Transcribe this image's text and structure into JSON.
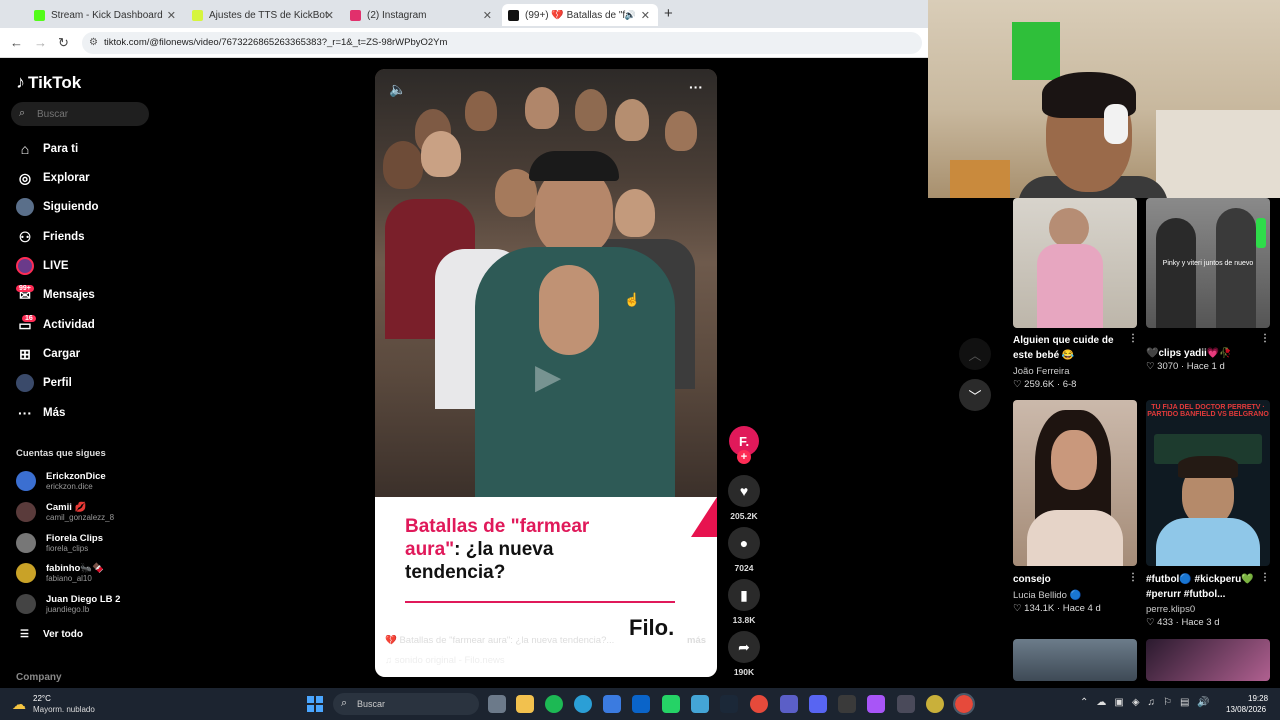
{
  "browser": {
    "tabs": [
      {
        "title": "Stream - Kick Dashboard",
        "favicon_color": "#53fc18"
      },
      {
        "title": "Ajustes de TTS de KickBot",
        "favicon_color": "#d6f53d"
      },
      {
        "title": "(2) Instagram",
        "favicon_color": "#e1306c"
      },
      {
        "title": "(99+) 💔 Batallas de \"farme",
        "favicon_color": "#111111"
      }
    ],
    "close_glyph": "✕",
    "new_tab_glyph": "+",
    "url": "tiktok.com/@filonews/video/7673226865263365383?_r=1&_t=ZS-98rWPbyO2Ym"
  },
  "sidebar": {
    "brand": "TikTok",
    "search_placeholder": "Buscar",
    "nav": [
      {
        "label": "Para ti",
        "icon": "home-icon"
      },
      {
        "label": "Explorar",
        "icon": "compass-icon"
      },
      {
        "label": "Siguiendo",
        "icon": "following-icon"
      },
      {
        "label": "Friends",
        "icon": "friends-icon"
      },
      {
        "label": "LIVE",
        "icon": "live-icon"
      },
      {
        "label": "Mensajes",
        "icon": "messages-icon",
        "badge": "99+"
      },
      {
        "label": "Actividad",
        "icon": "activity-icon",
        "badge": "16"
      },
      {
        "label": "Cargar",
        "icon": "upload-icon"
      },
      {
        "label": "Perfil",
        "icon": "profile-icon"
      },
      {
        "label": "Más",
        "icon": "more-icon"
      }
    ],
    "following_title": "Cuentas que sigues",
    "following": [
      {
        "name": "ErickzonDice",
        "handle": "erickzon.dice",
        "color": "#3b6fd1"
      },
      {
        "name": "Camii 💋",
        "handle": "camil_gonzalezz_8",
        "color": "#5a3b3b"
      },
      {
        "name": "Fiorela Clips",
        "handle": "fiorela_clips",
        "color": "#777777"
      },
      {
        "name": "fabinho🐜🍫",
        "handle": "fabiano_al10",
        "color": "#c9a227"
      },
      {
        "name": "Juan Diego LB 2",
        "handle": "juandiego.lb",
        "color": "#444444"
      }
    ],
    "see_all": "Ver todo",
    "company": "Company"
  },
  "video": {
    "headline_pink": "Batallas de \"farmear aura\"",
    "headline_rest": ": ¿la nueva tendencia?",
    "logo": "Filo.",
    "author": "Filo.news",
    "time": "Hace 1 d",
    "description": "💔 Batallas de \"farmear aura\": ¿la nueva tendencia?...",
    "more": "más",
    "sound": "♫ sonido original - Filo.news",
    "creator_initial": "F.",
    "likes": "205.2K",
    "comments": "7024",
    "saves": "13.8K",
    "shares": "190K"
  },
  "grid": [
    {
      "title": "Alguien que cuide de este bebé 😂",
      "author": "João Ferreira",
      "meta": "♡ 259.6K · 6-8"
    },
    {
      "title": "🖤clips yadii💗🥀",
      "author": "",
      "meta": "♡ 3070 · Hace 1 d",
      "overlay": "Pinky y viteri juntos de nuevo"
    },
    {
      "title": "consejo",
      "author": "Lucia Bellido 🔵",
      "meta": "♡ 134.1K · Hace 4 d"
    },
    {
      "title": "#futbol🔵 #kickperu💚 #perurr #futbol...",
      "author": "perre.klips0",
      "meta": "♡ 433 · Hace 3 d",
      "overlay": "TU FIJA DEL DOCTOR PERRETV · PARTIDO BANFIELD VS BELGRANO"
    }
  ],
  "taskbar": {
    "temp": "22°C",
    "condition": "Mayorm. nublado",
    "search": "Buscar",
    "time": "19:28",
    "date": "13/08/2026"
  }
}
